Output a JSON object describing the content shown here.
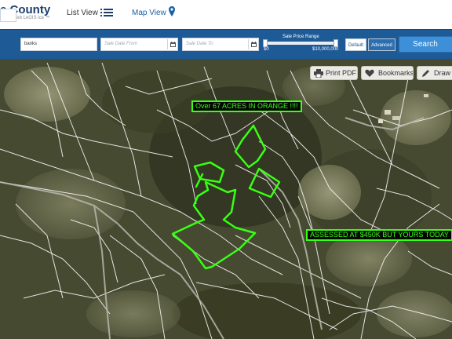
{
  "header": {
    "brand_title": "e County",
    "brand_subtitle": "ioo Web LeGIS ice ™",
    "nav": {
      "list_view": "List View",
      "map_view": "Map View"
    }
  },
  "filters": {
    "field_1": "",
    "field_2": "banks",
    "sale_date_from": "Sale Date From",
    "sale_date_to": "Sale Date To",
    "price_range_title": "Sale Price Range",
    "price_min": "$0",
    "price_max": "$10,000,000",
    "toggle_default": "Default",
    "toggle_advanced": "Advanced",
    "search_label": "Search"
  },
  "map_toolbar": {
    "print_pdf": "Print PDF",
    "bookmarks": "Bookmarks",
    "draw": "Draw T"
  },
  "annotations": {
    "top": "Over 67 ACRES IN ORANGE !!!!",
    "right": "ASSESSED AT $450K BUT YOURS TODAY"
  },
  "colors": {
    "filter_bar": "#1d5a96",
    "brand": "#1c3f6e",
    "search_button": "#3d8fd8",
    "outline": "#39ff14",
    "parcel_lines": "#ffffff"
  }
}
